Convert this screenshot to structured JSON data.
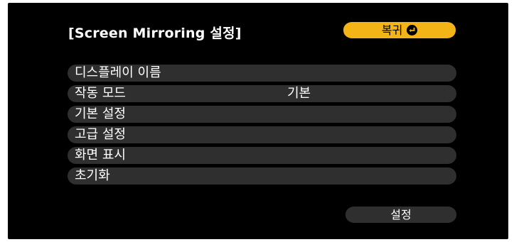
{
  "header": {
    "title": "[Screen Mirroring 설정]",
    "return_label": "복귀",
    "return_icon": "return-arrow-icon"
  },
  "menu": {
    "items": [
      {
        "label": "디스플레이 이름",
        "value": ""
      },
      {
        "label": "작동 모드",
        "value": "기본"
      },
      {
        "label": "기본 설정",
        "value": ""
      },
      {
        "label": "고급 설정",
        "value": ""
      },
      {
        "label": "화면 표시",
        "value": ""
      },
      {
        "label": "초기화",
        "value": ""
      }
    ]
  },
  "footer": {
    "set_label": "설정"
  },
  "colors": {
    "background": "#000000",
    "accent": "#f2b417",
    "item_bg": "#2f2f2f",
    "text": "#ffffff"
  }
}
